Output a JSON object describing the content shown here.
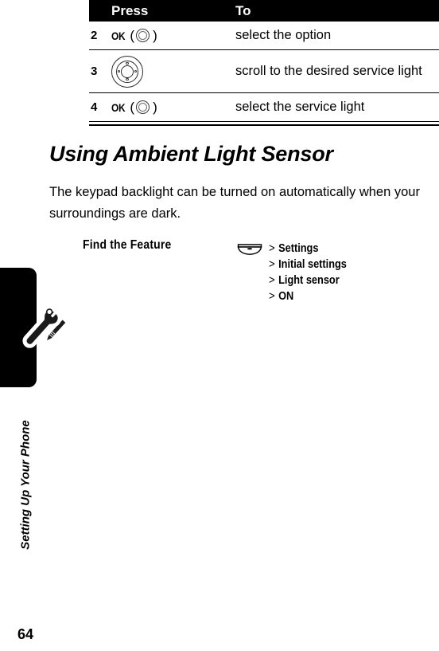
{
  "table": {
    "headers": {
      "num": "",
      "press": "Press",
      "to": "To"
    },
    "rows": [
      {
        "num": "2",
        "press_label": "OK",
        "press_icon": "ok-round-key-icon",
        "paren_open": "(",
        "paren_close": ")",
        "to": "select the option"
      },
      {
        "num": "3",
        "press_label": "",
        "press_icon": "navigation-key-icon",
        "paren_open": "",
        "paren_close": "",
        "to": "scroll to the desired service light"
      },
      {
        "num": "4",
        "press_label": "OK",
        "press_icon": "ok-round-key-icon",
        "paren_open": "(",
        "paren_close": ")",
        "to": "select the service light"
      }
    ]
  },
  "section": {
    "heading": "Using Ambient Light Sensor",
    "paragraph": "The keypad backlight can be turned on automatically when your surroundings are dark."
  },
  "find_feature": {
    "label": "Find the Feature",
    "key_icon": "menu-key-icon",
    "separator": ">",
    "path": [
      "Settings",
      "Initial settings",
      "Light sensor",
      "ON"
    ]
  },
  "sidebar": {
    "icon": "wrench-screwdriver-icon"
  },
  "footer": {
    "running_head": "Setting Up Your Phone",
    "page_number": "64"
  },
  "colors": {
    "ink": "#000000",
    "paper": "#ffffff",
    "header_bar": "#000000",
    "header_text": "#ffffff"
  }
}
